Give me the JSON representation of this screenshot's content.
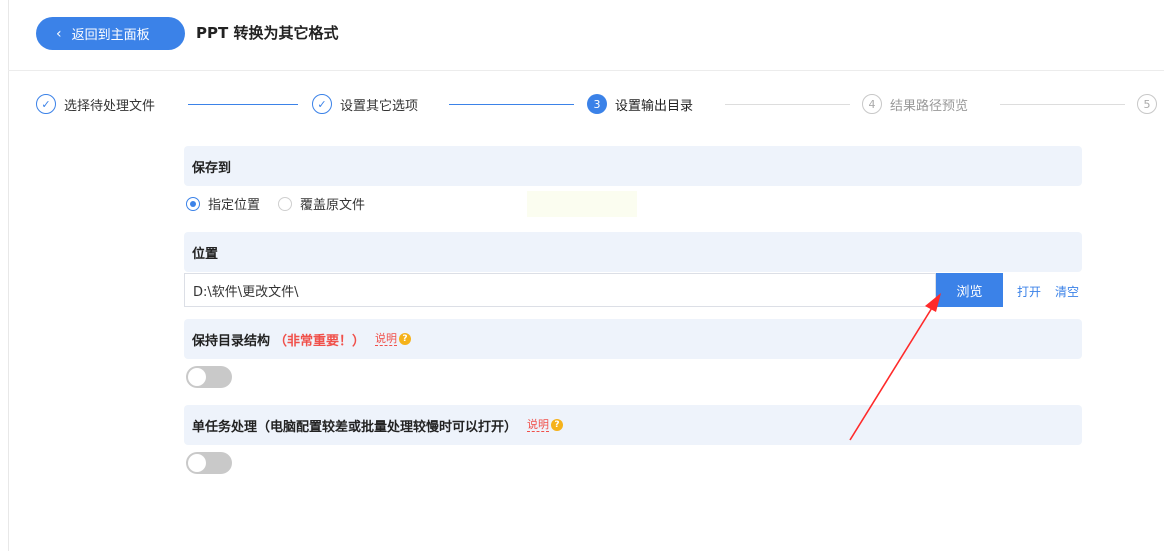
{
  "header": {
    "back_label": "返回到主面板",
    "title": "PPT 转换为其它格式"
  },
  "steps": [
    {
      "number": "1",
      "label": "选择待处理文件",
      "state": "done"
    },
    {
      "number": "2",
      "label": "设置其它选项",
      "state": "done"
    },
    {
      "number": "3",
      "label": "设置输出目录",
      "state": "active"
    },
    {
      "number": "4",
      "label": "结果路径预览",
      "state": "todo"
    },
    {
      "number": "5",
      "label": "",
      "state": "todo"
    }
  ],
  "save_to": {
    "heading": "保存到",
    "options": [
      {
        "label": "指定位置",
        "selected": true
      },
      {
        "label": "覆盖原文件",
        "selected": false
      }
    ]
  },
  "location": {
    "heading": "位置",
    "path_value": "D:\\软件\\更改文件\\",
    "browse_label": "浏览",
    "open_label": "打开",
    "clear_label": "清空"
  },
  "keep_structure": {
    "heading": "保持目录结构",
    "warning": "（非常重要！）",
    "help_label": "说明",
    "enabled": false
  },
  "single_task": {
    "heading": "单任务处理（电脑配置较差或批量处理较慢时可以打开）",
    "help_label": "说明",
    "enabled": false
  },
  "colors": {
    "accent": "#3b82e8",
    "warning": "#f0504a",
    "section_bg": "#eef3fb",
    "annotation_arrow": "#ff2a2a"
  }
}
